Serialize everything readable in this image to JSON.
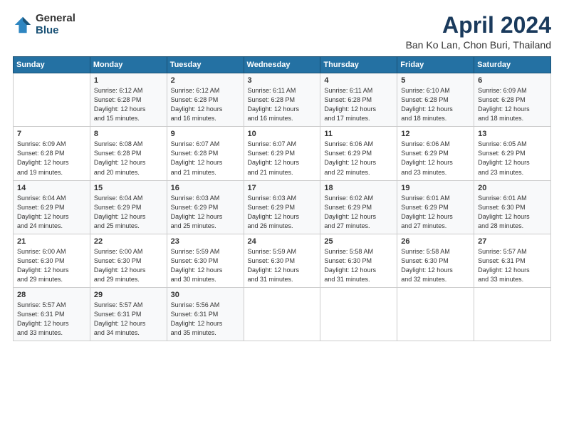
{
  "logo": {
    "general": "General",
    "blue": "Blue"
  },
  "header": {
    "title": "April 2024",
    "subtitle": "Ban Ko Lan, Chon Buri, Thailand"
  },
  "weekdays": [
    "Sunday",
    "Monday",
    "Tuesday",
    "Wednesday",
    "Thursday",
    "Friday",
    "Saturday"
  ],
  "weeks": [
    [
      {
        "day": "",
        "info": ""
      },
      {
        "day": "1",
        "info": "Sunrise: 6:12 AM\nSunset: 6:28 PM\nDaylight: 12 hours\nand 15 minutes."
      },
      {
        "day": "2",
        "info": "Sunrise: 6:12 AM\nSunset: 6:28 PM\nDaylight: 12 hours\nand 16 minutes."
      },
      {
        "day": "3",
        "info": "Sunrise: 6:11 AM\nSunset: 6:28 PM\nDaylight: 12 hours\nand 16 minutes."
      },
      {
        "day": "4",
        "info": "Sunrise: 6:11 AM\nSunset: 6:28 PM\nDaylight: 12 hours\nand 17 minutes."
      },
      {
        "day": "5",
        "info": "Sunrise: 6:10 AM\nSunset: 6:28 PM\nDaylight: 12 hours\nand 18 minutes."
      },
      {
        "day": "6",
        "info": "Sunrise: 6:09 AM\nSunset: 6:28 PM\nDaylight: 12 hours\nand 18 minutes."
      }
    ],
    [
      {
        "day": "7",
        "info": "Sunrise: 6:09 AM\nSunset: 6:28 PM\nDaylight: 12 hours\nand 19 minutes."
      },
      {
        "day": "8",
        "info": "Sunrise: 6:08 AM\nSunset: 6:28 PM\nDaylight: 12 hours\nand 20 minutes."
      },
      {
        "day": "9",
        "info": "Sunrise: 6:07 AM\nSunset: 6:28 PM\nDaylight: 12 hours\nand 21 minutes."
      },
      {
        "day": "10",
        "info": "Sunrise: 6:07 AM\nSunset: 6:29 PM\nDaylight: 12 hours\nand 21 minutes."
      },
      {
        "day": "11",
        "info": "Sunrise: 6:06 AM\nSunset: 6:29 PM\nDaylight: 12 hours\nand 22 minutes."
      },
      {
        "day": "12",
        "info": "Sunrise: 6:06 AM\nSunset: 6:29 PM\nDaylight: 12 hours\nand 23 minutes."
      },
      {
        "day": "13",
        "info": "Sunrise: 6:05 AM\nSunset: 6:29 PM\nDaylight: 12 hours\nand 23 minutes."
      }
    ],
    [
      {
        "day": "14",
        "info": "Sunrise: 6:04 AM\nSunset: 6:29 PM\nDaylight: 12 hours\nand 24 minutes."
      },
      {
        "day": "15",
        "info": "Sunrise: 6:04 AM\nSunset: 6:29 PM\nDaylight: 12 hours\nand 25 minutes."
      },
      {
        "day": "16",
        "info": "Sunrise: 6:03 AM\nSunset: 6:29 PM\nDaylight: 12 hours\nand 25 minutes."
      },
      {
        "day": "17",
        "info": "Sunrise: 6:03 AM\nSunset: 6:29 PM\nDaylight: 12 hours\nand 26 minutes."
      },
      {
        "day": "18",
        "info": "Sunrise: 6:02 AM\nSunset: 6:29 PM\nDaylight: 12 hours\nand 27 minutes."
      },
      {
        "day": "19",
        "info": "Sunrise: 6:01 AM\nSunset: 6:29 PM\nDaylight: 12 hours\nand 27 minutes."
      },
      {
        "day": "20",
        "info": "Sunrise: 6:01 AM\nSunset: 6:30 PM\nDaylight: 12 hours\nand 28 minutes."
      }
    ],
    [
      {
        "day": "21",
        "info": "Sunrise: 6:00 AM\nSunset: 6:30 PM\nDaylight: 12 hours\nand 29 minutes."
      },
      {
        "day": "22",
        "info": "Sunrise: 6:00 AM\nSunset: 6:30 PM\nDaylight: 12 hours\nand 29 minutes."
      },
      {
        "day": "23",
        "info": "Sunrise: 5:59 AM\nSunset: 6:30 PM\nDaylight: 12 hours\nand 30 minutes."
      },
      {
        "day": "24",
        "info": "Sunrise: 5:59 AM\nSunset: 6:30 PM\nDaylight: 12 hours\nand 31 minutes."
      },
      {
        "day": "25",
        "info": "Sunrise: 5:58 AM\nSunset: 6:30 PM\nDaylight: 12 hours\nand 31 minutes."
      },
      {
        "day": "26",
        "info": "Sunrise: 5:58 AM\nSunset: 6:30 PM\nDaylight: 12 hours\nand 32 minutes."
      },
      {
        "day": "27",
        "info": "Sunrise: 5:57 AM\nSunset: 6:31 PM\nDaylight: 12 hours\nand 33 minutes."
      }
    ],
    [
      {
        "day": "28",
        "info": "Sunrise: 5:57 AM\nSunset: 6:31 PM\nDaylight: 12 hours\nand 33 minutes."
      },
      {
        "day": "29",
        "info": "Sunrise: 5:57 AM\nSunset: 6:31 PM\nDaylight: 12 hours\nand 34 minutes."
      },
      {
        "day": "30",
        "info": "Sunrise: 5:56 AM\nSunset: 6:31 PM\nDaylight: 12 hours\nand 35 minutes."
      },
      {
        "day": "",
        "info": ""
      },
      {
        "day": "",
        "info": ""
      },
      {
        "day": "",
        "info": ""
      },
      {
        "day": "",
        "info": ""
      }
    ]
  ]
}
